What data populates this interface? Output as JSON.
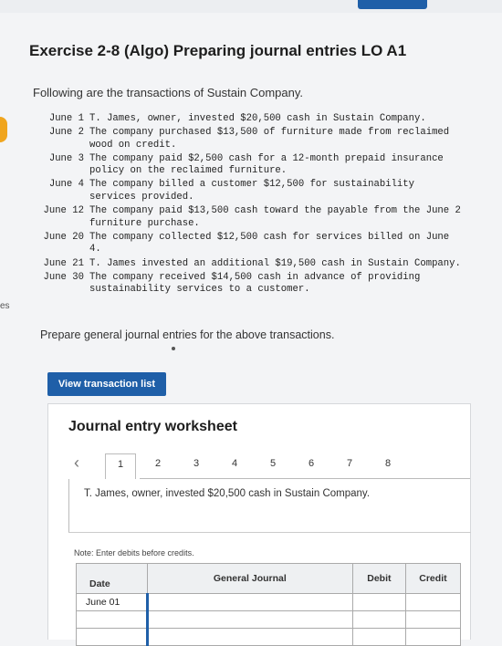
{
  "page": {
    "title": "Exercise 2-8 (Algo) Preparing journal entries LO A1",
    "intro": "Following are the transactions of Sustain Company.",
    "left_fragment": "es",
    "prepare": "Prepare general journal entries for the above transactions."
  },
  "transactions": [
    {
      "date": "June 1",
      "text": "T. James, owner, invested $20,500 cash in Sustain Company."
    },
    {
      "date": "June 2",
      "text": "The company purchased $13,500 of furniture made from reclaimed wood on credit."
    },
    {
      "date": "June 3",
      "text": "The company paid $2,500 cash for a 12-month prepaid insurance policy on the reclaimed furniture."
    },
    {
      "date": "June 4",
      "text": "The company billed a customer $12,500 for sustainability services provided."
    },
    {
      "date": "June 12",
      "text": "The company paid $13,500 cash toward the payable from the June 2 furniture purchase."
    },
    {
      "date": "June 20",
      "text": "The company collected $12,500 cash for services billed on June 4."
    },
    {
      "date": "June 21",
      "text": "T. James invested an additional $19,500 cash in Sustain Company."
    },
    {
      "date": "June 30",
      "text": "The company received $14,500 cash in advance of providing sustainability services to a customer."
    }
  ],
  "buttons": {
    "view_transactions": "View transaction list"
  },
  "worksheet": {
    "title": "Journal entry worksheet",
    "tabs": [
      "1",
      "2",
      "3",
      "4",
      "5",
      "6",
      "7",
      "8"
    ],
    "active_tab": 0,
    "prompt": "T. James, owner, invested $20,500 cash in Sustain Company.",
    "note": "Note: Enter debits before credits.",
    "columns": {
      "date": "Date",
      "account": "General Journal",
      "debit": "Debit",
      "credit": "Credit"
    },
    "rows": [
      {
        "date": "June 01",
        "account": "",
        "debit": "",
        "credit": ""
      },
      {
        "date": "",
        "account": "",
        "debit": "",
        "credit": ""
      },
      {
        "date": "",
        "account": "",
        "debit": "",
        "credit": ""
      }
    ]
  }
}
